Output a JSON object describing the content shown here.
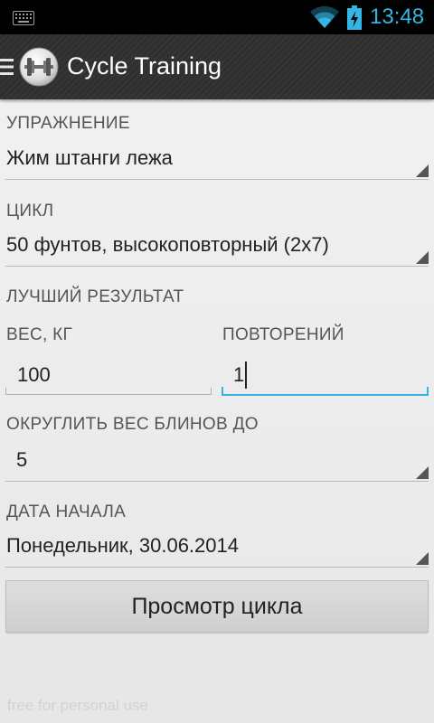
{
  "status_bar": {
    "time": "13:48",
    "icons": [
      "keyboard-icon",
      "wifi-icon",
      "battery-charging-icon"
    ],
    "accent_color": "#33b5e5"
  },
  "action_bar": {
    "title": "Cycle Training",
    "icons": [
      "menu-icon",
      "app-logo-icon"
    ]
  },
  "form": {
    "exercise": {
      "label": "УПРАЖНЕНИЕ",
      "value": "Жим штанги лежа"
    },
    "cycle": {
      "label": "ЦИКЛ",
      "value": "50 фунтов, высокоповторный (2x7)"
    },
    "best_result": {
      "label": "ЛУЧШИЙ РЕЗУЛЬТАТ",
      "weight": {
        "label": "ВЕС, КГ",
        "value": "100"
      },
      "reps": {
        "label": "ПОВТОРЕНИЙ",
        "value": "1"
      }
    },
    "plate_rounding": {
      "label": "ОКРУГЛИТЬ ВЕС БЛИНОВ ДО",
      "value": "5"
    },
    "start_date": {
      "label": "ДАТА НАЧАЛА",
      "value": "Понедельник, 30.06.2014"
    }
  },
  "view_cycle_button": "Просмотр цикла",
  "watermark": "free for personal use"
}
